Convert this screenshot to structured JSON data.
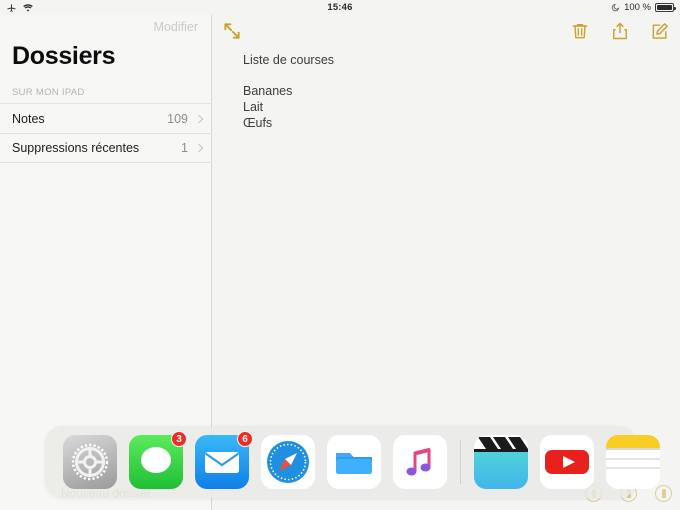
{
  "statusbar": {
    "airplane_icon": "airplane-icon",
    "wifi_icon": "wifi-icon",
    "time": "15:46",
    "dnd_icon": "moon-icon",
    "battery_percent": "100 %",
    "battery_icon": "battery-full-icon"
  },
  "sidebar": {
    "edit_label": "Modifier",
    "title": "Dossiers",
    "section_header": "SUR MON IPAD",
    "new_folder_label": "Nouveau dossier",
    "folders": [
      {
        "label": "Notes",
        "count": "109"
      },
      {
        "label": "Suppressions récentes",
        "count": "1"
      }
    ]
  },
  "note": {
    "toolbar": {
      "expand_icon": "expand-arrows-icon",
      "trash_icon": "trash-icon",
      "share_icon": "share-icon",
      "compose_icon": "compose-icon"
    },
    "title": "Liste de courses",
    "lines": [
      "Bananes",
      "Lait",
      "Œufs"
    ]
  },
  "dock": {
    "apps": [
      {
        "name": "settings",
        "label": "Réglages",
        "badge": ""
      },
      {
        "name": "messages",
        "label": "Messages",
        "badge": "3"
      },
      {
        "name": "mail",
        "label": "Mail",
        "badge": "6"
      },
      {
        "name": "safari",
        "label": "Safari",
        "badge": ""
      },
      {
        "name": "files",
        "label": "Fichiers",
        "badge": ""
      },
      {
        "name": "music",
        "label": "Musique",
        "badge": ""
      },
      {
        "name": "imovie",
        "label": "iMovie",
        "badge": ""
      },
      {
        "name": "youtube",
        "label": "YouTube",
        "badge": ""
      },
      {
        "name": "notes",
        "label": "Notes",
        "badge": ""
      }
    ]
  },
  "colors": {
    "accent_gold": "#c9a227",
    "badge_red": "#f02b25",
    "background": "#f4f4f2",
    "sidebar": "#f7f7f5"
  }
}
